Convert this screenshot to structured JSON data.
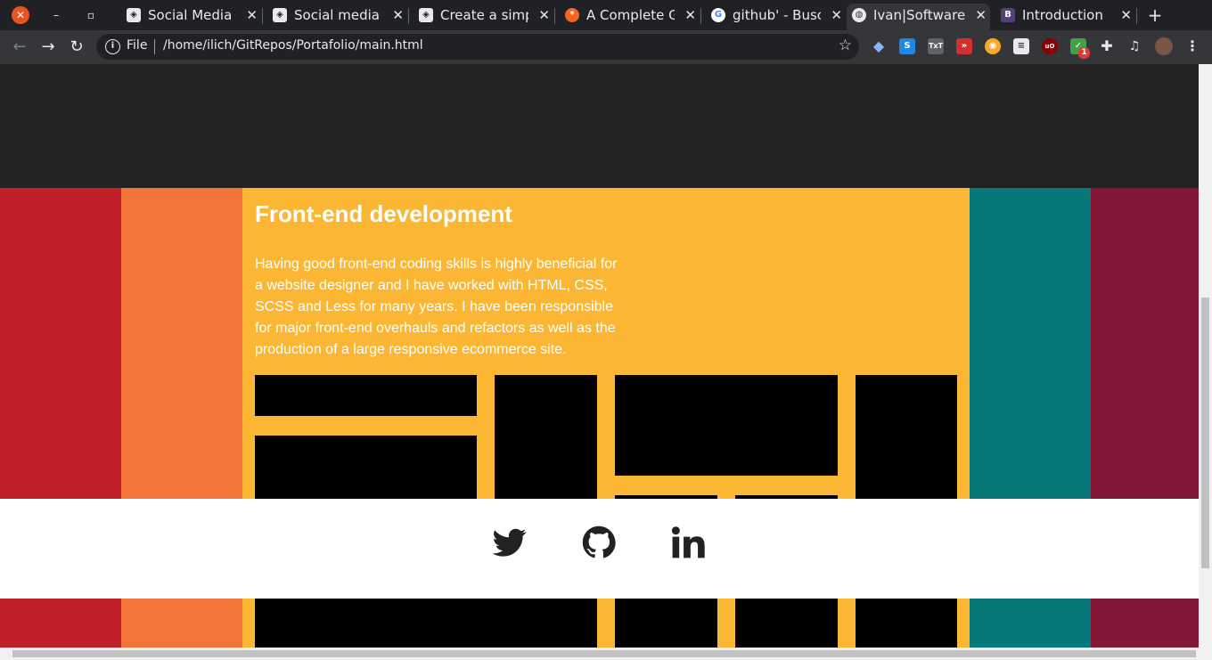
{
  "browser": {
    "tabs": [
      {
        "title": "Social Media Ic",
        "favicon": "codepen-icon"
      },
      {
        "title": "Social media h",
        "favicon": "codepen-icon"
      },
      {
        "title": "Create a simpl",
        "favicon": "codepen-icon"
      },
      {
        "title": "A Complete Gu",
        "favicon": "css-tricks-icon"
      },
      {
        "title": "github' - Busca",
        "favicon": "google-icon"
      },
      {
        "title": "Ivan|Software",
        "favicon": "globe-icon",
        "active": true
      },
      {
        "title": "Introduction",
        "favicon": "bootstrap-icon"
      }
    ],
    "address": {
      "scheme_label": "File",
      "url": "/home/ilich/GitRepos/Portafolio/main.html"
    },
    "extension_badge": "1"
  },
  "page": {
    "section": {
      "title": "Front-end development",
      "description": "Having good front-end coding skills is highly beneficial for a website designer and I have worked with HTML, CSS, SCSS and Less for many years. I have been responsible for major front-end overhauls and refactors as well as the production of a large responsive ecommerce site."
    },
    "stripe_colors": [
      "#c02129",
      "#f27438",
      "#fbb733",
      "#06787a",
      "#841736"
    ],
    "social_links": [
      {
        "name": "twitter-icon"
      },
      {
        "name": "github-icon"
      },
      {
        "name": "linkedin-icon"
      }
    ]
  }
}
